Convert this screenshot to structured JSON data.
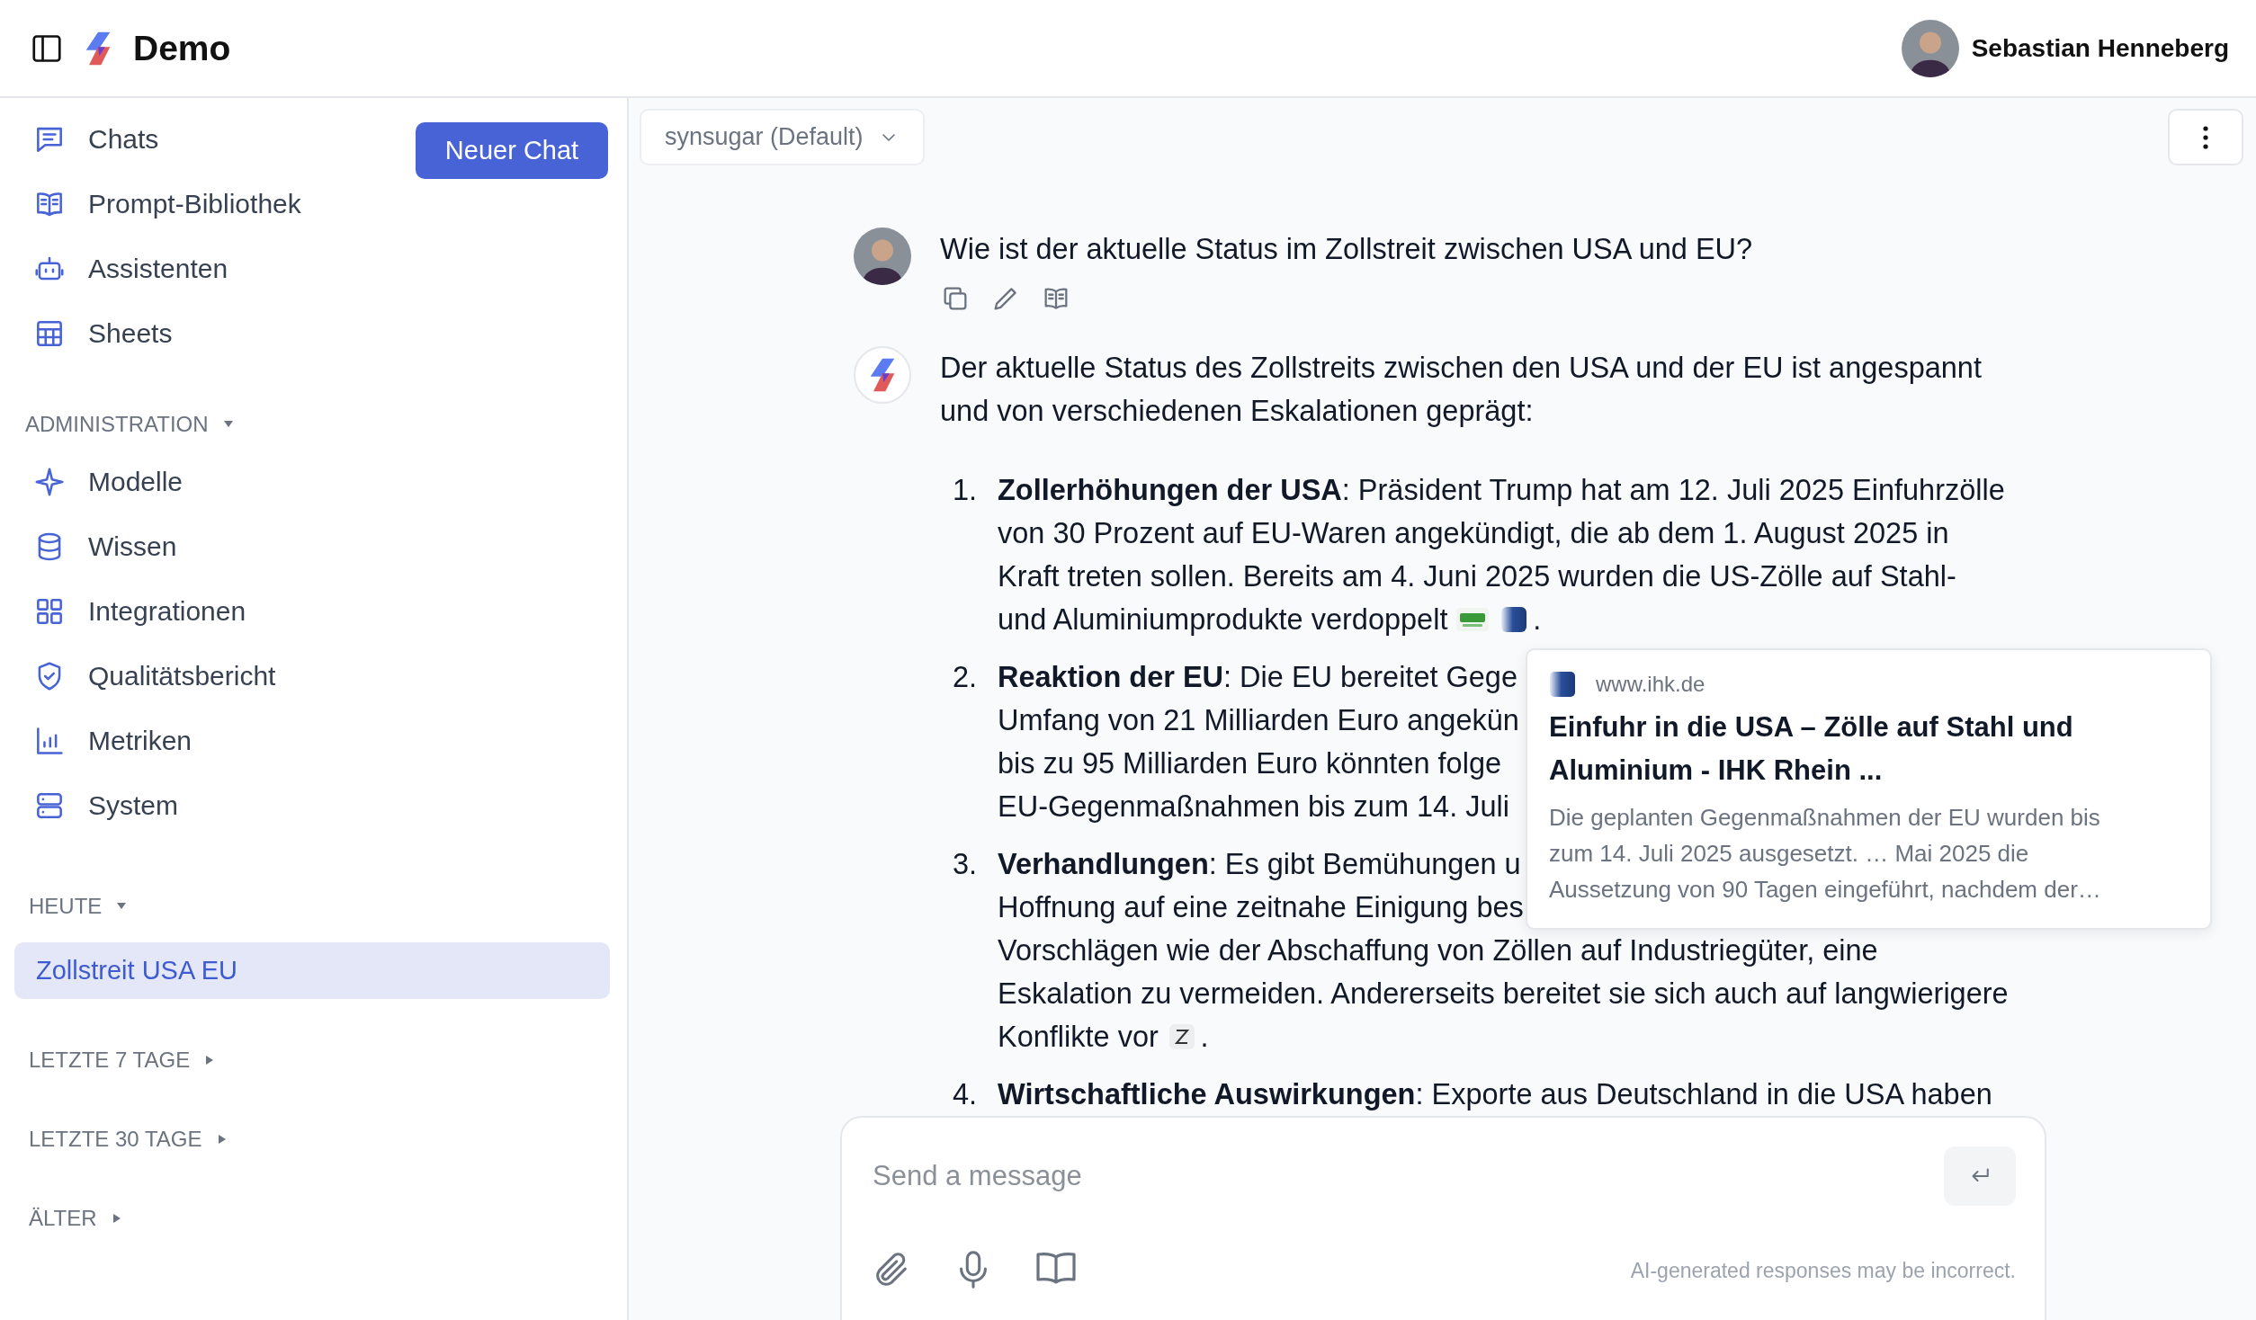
{
  "header": {
    "title": "Demo",
    "user": "Sebastian Henneberg"
  },
  "sidebar": {
    "new_chat": "Neuer Chat",
    "nav": [
      {
        "label": "Chats"
      },
      {
        "label": "Prompt-Bibliothek"
      },
      {
        "label": "Assistenten"
      },
      {
        "label": "Sheets"
      }
    ],
    "admin": {
      "label": "ADMINISTRATION",
      "expanded": true,
      "items": [
        {
          "label": "Modelle"
        },
        {
          "label": "Wissen"
        },
        {
          "label": "Integrationen"
        },
        {
          "label": "Qualitätsbericht"
        },
        {
          "label": "Metriken"
        },
        {
          "label": "System"
        }
      ]
    },
    "history": [
      {
        "label": "HEUTE",
        "expanded": true,
        "chats": [
          {
            "title": "Zollstreit USA EU",
            "selected": true
          }
        ]
      },
      {
        "label": "LETZTE 7 TAGE",
        "expanded": false
      },
      {
        "label": "LETZTE 30 TAGE",
        "expanded": false
      },
      {
        "label": "ÄLTER",
        "expanded": false
      }
    ]
  },
  "model_select": {
    "value": "synsugar (Default)"
  },
  "messages": [
    {
      "kind": "user",
      "text": "Wie ist der aktuelle Status im Zollstreit zwischen USA und EU?"
    },
    {
      "kind": "assistant",
      "intro_lines": [
        "Der aktuelle Status des Zollstreits zwischen den USA und der EU ist angespannt",
        "und von verschiedenen Eskalationen geprägt:"
      ],
      "list": [
        {
          "number": "1.",
          "lines": [
            "**Zollerhöhungen der USA**: Präsident Trump hat am 12. Juli 2025 Einfuhrzölle",
            "von 30 Prozent auf EU-Waren angekündigt, die ab dem 1. August 2025 in",
            "Kraft treten sollen. Bereits am 4. Juni 2025 wurden die US-Zölle auf Stahl-",
            "und Aluminiumprodukte verdoppelt"
          ],
          "end": "."
        },
        {
          "number": "2.",
          "lines": [
            "**Reaktion der EU**: Die EU bereitet Gege",
            "Umfang von 21 Milliarden Euro angekün",
            "bis zu 95 Milliarden Euro könnten folge",
            "EU-Gegenmaßnahmen bis zum 14. Juli"
          ]
        },
        {
          "number": "3.",
          "lines": [
            "**Verhandlungen**: Es gibt Bemühungen u",
            "Hoffnung auf eine zeitnahe Einigung bes",
            "Vorschlägen wie der Abschaffung von Zöllen auf Industriegüter, eine",
            "Eskalation zu vermeiden. Andererseits bereitet sie sich auch auf langwierigere",
            "Konflikte vor"
          ],
          "end": "."
        },
        {
          "number": "4.",
          "lines": [
            "**Wirtschaftliche Auswirkungen**: Exporte aus Deutschland in die USA haben"
          ]
        }
      ]
    }
  ],
  "citation_popup": {
    "domain": "www.ihk.de",
    "title": "Einfuhr in die USA – Zölle auf Stahl und Aluminium - IHK Rhein ...",
    "snippet": "Die geplanten Gegenmaßnahmen der EU wurden bis zum 14. Juli 2025 ausgesetzt. … Mai 2025 die Aussetzung von 90 Tagen eingeführt, nachdem der…"
  },
  "composer": {
    "placeholder": "Send a message",
    "disclaimer": "AI-generated responses may be incorrect."
  }
}
